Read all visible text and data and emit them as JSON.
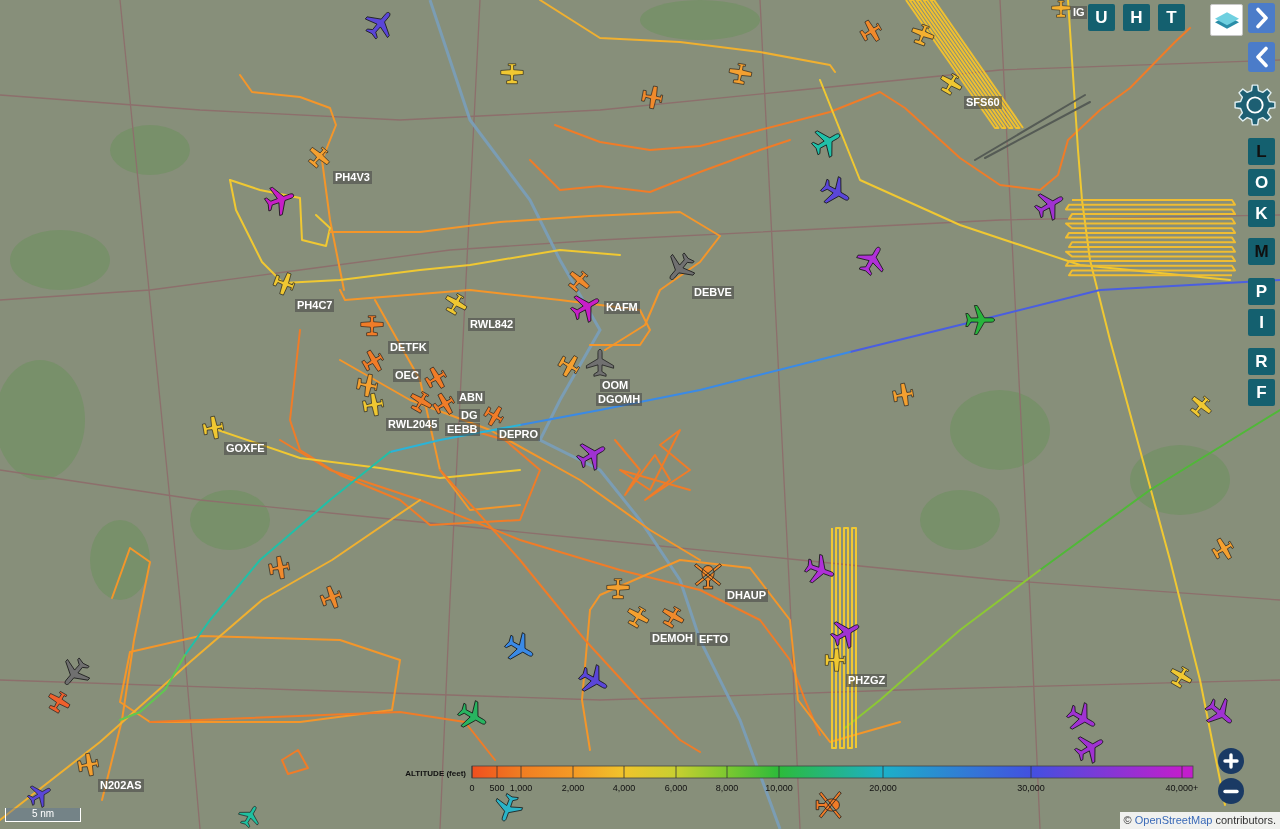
{
  "map": {
    "callsigns": [
      "IG",
      "SFS60",
      "PH4V3",
      "DEBVE",
      "PH4C7",
      "KAFM",
      "RWL842",
      "DETFK",
      "OEC",
      "OOM",
      "ABN",
      "DGOMH",
      "DG",
      "RWL2045",
      "EEBB",
      "DEPRO",
      "GOXFE",
      "DHAUP",
      "DEMOH",
      "EFTO",
      "PHZGZ",
      "N202AS"
    ],
    "aircraft": [
      {
        "kind": "jet",
        "color": "#5a46d8"
      },
      {
        "kind": "prop",
        "color": "#f0c832"
      },
      {
        "kind": "prop",
        "color": "#f4a030"
      },
      {
        "kind": "prop",
        "color": "#f08a2c"
      },
      {
        "kind": "prop",
        "color": "#f08a2c"
      },
      {
        "kind": "prop",
        "color": "#f4b030"
      },
      {
        "kind": "prop",
        "color": "#f0c832"
      },
      {
        "kind": "prop",
        "color": "#f4b030"
      },
      {
        "kind": "jet",
        "color": "#20c0a8"
      },
      {
        "kind": "jet",
        "color": "#5a46d8"
      },
      {
        "kind": "jet",
        "color": "#a032d2"
      },
      {
        "kind": "jet",
        "color": "#b030d8"
      },
      {
        "kind": "prop",
        "color": "#f4a030"
      },
      {
        "kind": "jet",
        "color": "#c81ec8"
      },
      {
        "kind": "prop",
        "color": "#f0c832"
      },
      {
        "kind": "prop",
        "color": "#f0c832"
      },
      {
        "kind": "prop",
        "color": "#f08a2c"
      },
      {
        "kind": "jet",
        "color": "#c81ec8"
      },
      {
        "kind": "jet",
        "color": "#707070"
      },
      {
        "kind": "prop",
        "color": "#f07c28"
      },
      {
        "kind": "prop",
        "color": "#f07c28"
      },
      {
        "kind": "prop",
        "color": "#f4a030"
      },
      {
        "kind": "prop",
        "color": "#f0c832"
      },
      {
        "kind": "prop",
        "color": "#f07c28"
      },
      {
        "kind": "prop",
        "color": "#f07c28"
      },
      {
        "kind": "prop",
        "color": "#f07c28"
      },
      {
        "kind": "prop",
        "color": "#f07c28"
      },
      {
        "kind": "prop",
        "color": "#f4a030"
      },
      {
        "kind": "jet",
        "color": "#707070"
      },
      {
        "kind": "prop",
        "color": "#f0c832"
      },
      {
        "kind": "jet",
        "color": "#a032d2"
      },
      {
        "kind": "jet",
        "color": "#28b43c"
      },
      {
        "kind": "prop",
        "color": "#f4a030"
      },
      {
        "kind": "prop",
        "color": "#f0c832"
      },
      {
        "kind": "prop",
        "color": "#f4a030"
      },
      {
        "kind": "jet",
        "color": "#b030d8"
      },
      {
        "kind": "heli",
        "color": "#f08a2c"
      },
      {
        "kind": "prop",
        "color": "#f4a030"
      },
      {
        "kind": "prop",
        "color": "#f4a030"
      },
      {
        "kind": "prop",
        "color": "#f08a2c"
      },
      {
        "kind": "jet",
        "color": "#a032d2"
      },
      {
        "kind": "prop",
        "color": "#f0c832"
      },
      {
        "kind": "jet",
        "color": "#3a8ae6"
      },
      {
        "kind": "jet",
        "color": "#5a46d8"
      },
      {
        "kind": "jet",
        "color": "#28b460"
      },
      {
        "kind": "prop",
        "color": "#f08a2c"
      },
      {
        "kind": "prop",
        "color": "#f08a2c"
      },
      {
        "kind": "jet",
        "color": "#707070"
      },
      {
        "kind": "prop",
        "color": "#f0602c"
      },
      {
        "kind": "prop",
        "color": "#f4a030"
      },
      {
        "kind": "jet",
        "color": "#5a46d8"
      },
      {
        "kind": "jet",
        "color": "#20c0a0"
      },
      {
        "kind": "jet",
        "color": "#2ab4c8"
      },
      {
        "kind": "heli",
        "color": "#f07c28"
      },
      {
        "kind": "prop",
        "color": "#f0c832"
      },
      {
        "kind": "jet",
        "color": "#a032d2"
      },
      {
        "kind": "jet",
        "color": "#a032d2"
      },
      {
        "kind": "jet",
        "color": "#a032d2"
      }
    ]
  },
  "top_buttons": [
    "U",
    "H",
    "T"
  ],
  "side_button_groups": [
    [
      {
        "label": "L",
        "active": true
      },
      {
        "label": "O",
        "active": false
      },
      {
        "label": "K",
        "active": false
      }
    ],
    [
      {
        "label": "M",
        "active": true
      }
    ],
    [
      {
        "label": "P",
        "active": false
      },
      {
        "label": "I",
        "active": false
      }
    ],
    [
      {
        "label": "R",
        "active": false
      },
      {
        "label": "F",
        "active": false
      }
    ]
  ],
  "altitude_legend": {
    "title": "ALTITUDE (feet)",
    "ticks": [
      "0",
      "500",
      "1,000",
      "2,000",
      "4,000",
      "6,000",
      "8,000",
      "10,000",
      "20,000",
      "30,000",
      "40,000+"
    ]
  },
  "scale": "5 nm",
  "attribution": {
    "prefix": "©",
    "link": "OpenStreetMap",
    "suffix": "contributors."
  }
}
